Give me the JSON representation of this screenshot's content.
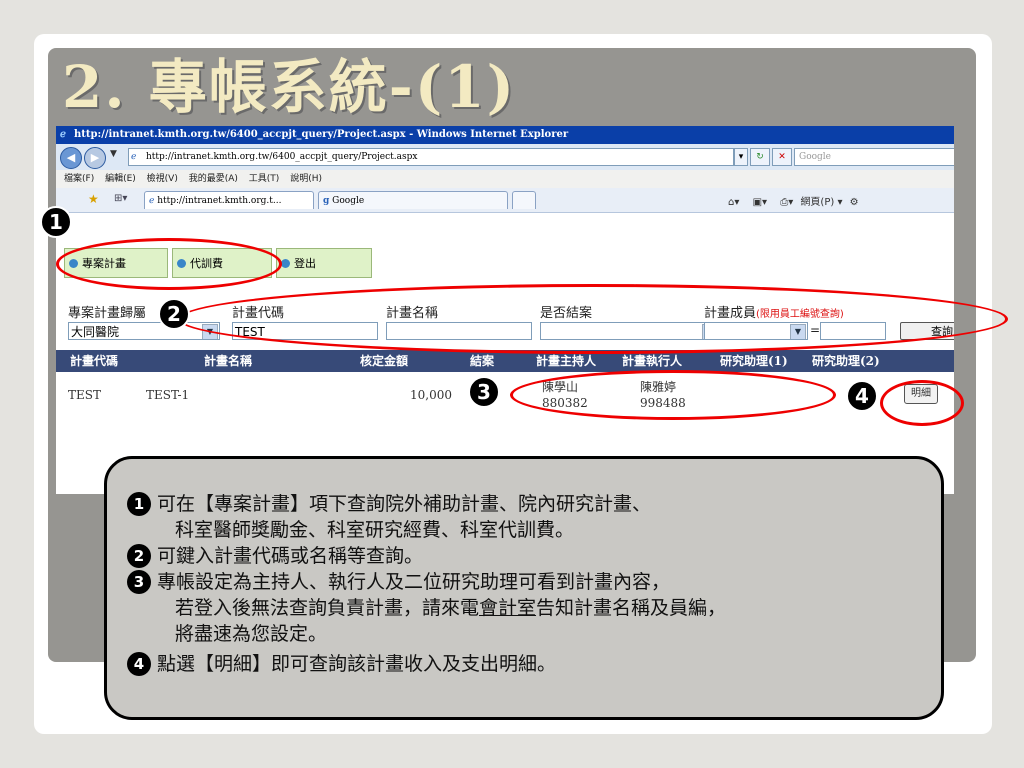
{
  "slide": {
    "title_number": "2.",
    "title_text": "專帳系統-(1)"
  },
  "browser": {
    "window_title": "http://intranet.kmth.org.tw/6400_accpjt_query/Project.aspx - Windows Internet Explorer",
    "url": "http://intranet.kmth.org.tw/6400_accpjt_query/Project.aspx",
    "search_placeholder": "Google",
    "menu": [
      "檔案(F)",
      "編輯(E)",
      "檢視(V)",
      "我的最愛(A)",
      "工具(T)",
      "說明(H)"
    ],
    "tabs": [
      {
        "label": "http://intranet.kmth.org.t..."
      },
      {
        "label": "Google"
      }
    ],
    "toolbar_right": "網頁(P) ▾"
  },
  "app": {
    "menu_items": [
      "專案計畫",
      "代訓費",
      "登出"
    ],
    "filters": {
      "unit_label": "專案計畫歸屬",
      "unit_value": "大同醫院",
      "code_label": "計畫代碼",
      "code_value": "TEST",
      "name_label": "計畫名稱",
      "name_value": "",
      "closed_label": "是否結案",
      "member_label": "計畫成員",
      "member_note": "(限用員工編號查詢)",
      "member_op": "=",
      "query_button": "查詢"
    },
    "columns": [
      "計畫代碼",
      "計畫名稱",
      "核定金額",
      "結案",
      "計畫主持人",
      "計畫執行人",
      "研究助理(1)",
      "研究助理(2)"
    ],
    "rows": [
      {
        "code": "TEST",
        "name": "TEST-1",
        "amount": "10,000",
        "pi_name": "陳學山",
        "pi_id": "880382",
        "exec_name": "陳雅婷",
        "exec_id": "998488",
        "detail_button": "明細"
      }
    ]
  },
  "badges": [
    "1",
    "2",
    "3",
    "4"
  ],
  "notes": {
    "n1_line1": "可在【專案計畫】項下查詢院外補助計畫、院內研究計畫、",
    "n1_line2": "科室醫師獎勵金、科室研究經費、科室代訓費。",
    "n2": "可鍵入計畫代碼或名稱等查詢。",
    "n3_line1": "專帳設定為主持人、執行人及二位研究助理可看到計畫內容，",
    "n3_line2_a": "若登入後無法查詢負責計畫，請來電",
    "n3_line2_u": "會計室",
    "n3_line2_b": "告知計畫名稱及員編，",
    "n3_line3": "將盡速為您設定。",
    "n4": "點選【明細】即可查詢該計畫收入及支出明細。"
  },
  "colors": {
    "annotation": "#e00000",
    "grid_header": "#374a78",
    "menu_bg": "#dff2c8",
    "ie_title": "#0a3fa8"
  }
}
